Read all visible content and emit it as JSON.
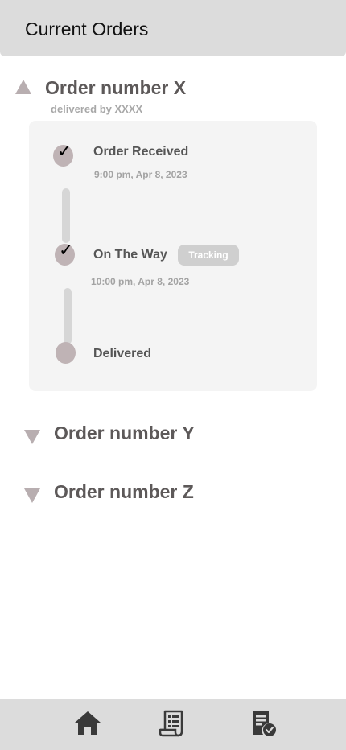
{
  "header": {
    "title": "Current Orders"
  },
  "orders": [
    {
      "title": "Order number X",
      "delivered_by": "delivered by XXXX",
      "expanded": true,
      "steps": [
        {
          "label": "Order Received",
          "time": "9:00 pm, Apr 8, 2023",
          "done": true
        },
        {
          "label": "On The Way",
          "time": "10:00 pm, Apr 8, 2023",
          "done": true,
          "action": "Tracking"
        },
        {
          "label": "Delivered",
          "time": "",
          "done": false
        }
      ]
    },
    {
      "title": "Order number Y",
      "expanded": false
    },
    {
      "title": "Order number Z",
      "expanded": false
    }
  ],
  "bottom_nav": {
    "items": [
      {
        "icon": "home-icon"
      },
      {
        "icon": "receipt-icon"
      },
      {
        "icon": "order-check-icon"
      }
    ]
  }
}
